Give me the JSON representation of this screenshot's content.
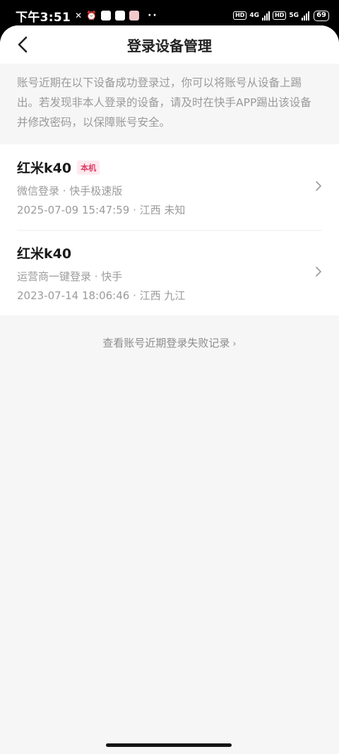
{
  "status_bar": {
    "time": "下午3:51",
    "net1": "4G",
    "net2": "5G",
    "battery": "69"
  },
  "header": {
    "title": "登录设备管理"
  },
  "notice": "账号近期在以下设备成功登录过，你可以将账号从设备上踢出。若发现非本人登录的设备，请及时在快手APP踢出该设备并修改密码，以保障账号安全。",
  "devices": [
    {
      "name": "红米k40",
      "badge": "本机",
      "login_info": "微信登录 · 快手极速版",
      "time_location": "2025-07-09 15:47:59 · 江西 未知"
    },
    {
      "name": "红米k40",
      "login_info": "运营商一键登录 · 快手",
      "time_location": "2023-07-14 18:06:46 · 江西 九江"
    }
  ],
  "fail_link": "查看账号近期登录失败记录",
  "colors": {
    "badge_bg": "#fde9ee",
    "badge_text": "#e23a63",
    "page_bg": "#f6f6f6"
  }
}
